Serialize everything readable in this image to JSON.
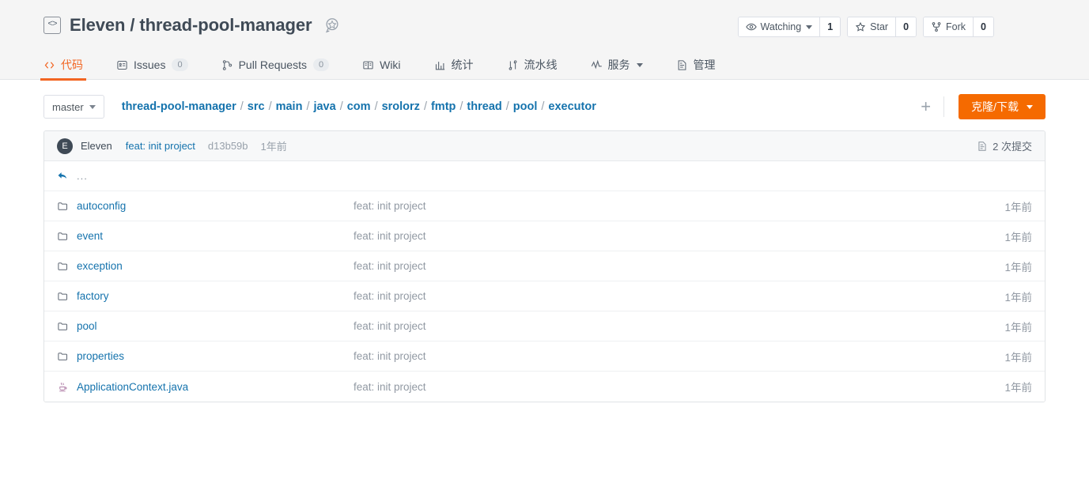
{
  "repo": {
    "owner": "Eleven",
    "name": "thread-pool-manager",
    "title": "Eleven / thread-pool-manager",
    "repo_icon": "code-brackets-icon",
    "badge_icon": "award-star-icon"
  },
  "actions": {
    "watch": {
      "icon": "eye-icon",
      "label": "Watching",
      "count": "1"
    },
    "star": {
      "icon": "star-icon",
      "label": "Star",
      "count": "0"
    },
    "fork": {
      "icon": "fork-icon",
      "label": "Fork",
      "count": "0"
    }
  },
  "tabs": [
    {
      "id": "code",
      "icon": "code-icon",
      "label": "代码",
      "count": null,
      "active": true,
      "dropdown": false
    },
    {
      "id": "issues",
      "icon": "issue-icon",
      "label": "Issues",
      "count": "0",
      "active": false,
      "dropdown": false
    },
    {
      "id": "pulls",
      "icon": "pull-request-icon",
      "label": "Pull Requests",
      "count": "0",
      "active": false,
      "dropdown": false
    },
    {
      "id": "wiki",
      "icon": "book-icon",
      "label": "Wiki",
      "count": null,
      "active": false,
      "dropdown": false
    },
    {
      "id": "stats",
      "icon": "chart-bar-icon",
      "label": "统计",
      "count": null,
      "active": false,
      "dropdown": false
    },
    {
      "id": "pipeline",
      "icon": "pipeline-icon",
      "label": "流水线",
      "count": null,
      "active": false,
      "dropdown": false
    },
    {
      "id": "service",
      "icon": "pulse-icon",
      "label": "服务",
      "count": null,
      "active": false,
      "dropdown": true
    },
    {
      "id": "manage",
      "icon": "settings-doc-icon",
      "label": "管理",
      "count": null,
      "active": false,
      "dropdown": false
    }
  ],
  "toolbar": {
    "branch": "master",
    "add_label": "+",
    "clone_label": "克隆/下载",
    "breadcrumb": [
      {
        "label": "thread-pool-manager"
      },
      {
        "label": "src"
      },
      {
        "label": "main"
      },
      {
        "label": "java"
      },
      {
        "label": "com"
      },
      {
        "label": "srolorz"
      },
      {
        "label": "fmtp"
      },
      {
        "label": "thread"
      },
      {
        "label": "pool"
      },
      {
        "label": "executor"
      }
    ],
    "breadcrumb_separator": "/"
  },
  "commit_bar": {
    "avatar_letter": "E",
    "author": "Eleven",
    "message": "feat: init project",
    "sha": "d13b59b",
    "time": "1年前",
    "commits_icon": "commit-history-icon",
    "commits_label": "2 次提交"
  },
  "files": {
    "parent_label": "...",
    "parent_icon": "arrow-up-back-icon",
    "rows": [
      {
        "icon": "folder-icon",
        "name": "autoconfig",
        "message": "feat: init project",
        "time": "1年前"
      },
      {
        "icon": "folder-icon",
        "name": "event",
        "message": "feat: init project",
        "time": "1年前"
      },
      {
        "icon": "folder-icon",
        "name": "exception",
        "message": "feat: init project",
        "time": "1年前"
      },
      {
        "icon": "folder-icon",
        "name": "factory",
        "message": "feat: init project",
        "time": "1年前"
      },
      {
        "icon": "folder-icon",
        "name": "pool",
        "message": "feat: init project",
        "time": "1年前"
      },
      {
        "icon": "folder-icon",
        "name": "properties",
        "message": "feat: init project",
        "time": "1年前"
      },
      {
        "icon": "java-file-icon",
        "name": "ApplicationContext.java",
        "message": "feat: init project",
        "time": "1年前"
      }
    ]
  },
  "colors": {
    "accent_orange": "#f26522",
    "clone_orange": "#f56a00",
    "link_blue": "#1573ad",
    "header_bg": "#f5f5f5",
    "muted": "#9199a3"
  }
}
